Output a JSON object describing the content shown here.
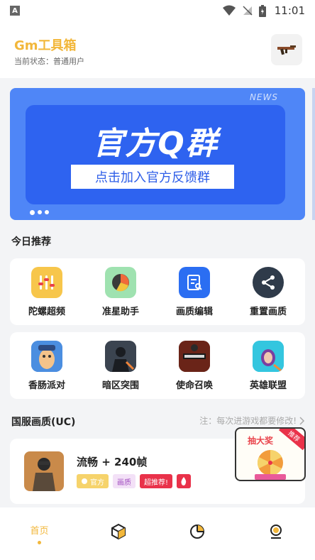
{
  "status_bar": {
    "time": "11:01",
    "left_icon": "A"
  },
  "header": {
    "title": "Gm工具箱",
    "status": "当前状态：普通用户",
    "action_icon": "gun-icon"
  },
  "banner": {
    "news_label": "NEWS",
    "headline": "官方Q群",
    "cta": "点击加入官方反馈群"
  },
  "today": {
    "title": "今日推荐",
    "tools": [
      {
        "label": "陀螺超频",
        "icon": "gyro-icon"
      },
      {
        "label": "准星助手",
        "icon": "crosshair-icon"
      },
      {
        "label": "画质编辑",
        "icon": "edit-icon"
      },
      {
        "label": "重置画质",
        "icon": "share-icon"
      }
    ],
    "games": [
      {
        "label": "香肠派对",
        "icon": "sausage-game-icon"
      },
      {
        "label": "暗区突围",
        "icon": "arena-breakout-icon"
      },
      {
        "label": "使命召唤",
        "icon": "call-of-duty-icon"
      },
      {
        "label": "英雄联盟",
        "icon": "league-icon"
      }
    ]
  },
  "cn_quality": {
    "title": "国服画质(UC)",
    "note": "注：每次进游戏都要修改!",
    "item": {
      "title": "流畅 + 240帧",
      "tags": [
        "官方",
        "画质",
        "超推荐!"
      ]
    }
  },
  "lottery": {
    "label": "抽大奖",
    "badge": "推荐"
  },
  "bottom_nav": {
    "home_label": "首页"
  },
  "colors": {
    "accent": "#f2b73b",
    "banner_blue": "#2e63f0",
    "red": "#e9324a"
  }
}
